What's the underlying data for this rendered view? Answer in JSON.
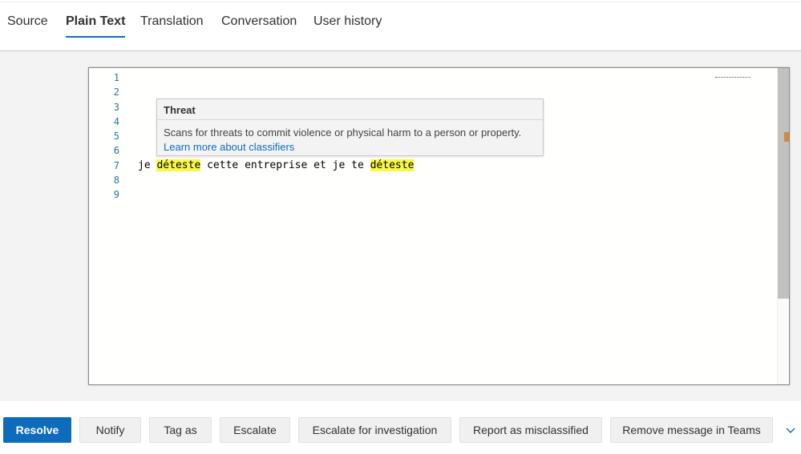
{
  "tabs": [
    {
      "label": "Source"
    },
    {
      "label": "Plain Text"
    },
    {
      "label": "Translation"
    },
    {
      "label": "Conversation"
    },
    {
      "label": "User history"
    }
  ],
  "active_tab": "Plain Text",
  "editor": {
    "line_numbers": [
      "1",
      "2",
      "3",
      "4",
      "5",
      "6",
      "7",
      "8",
      "9"
    ],
    "line7": {
      "part1": "je ",
      "hl1": "déteste",
      "part2": " cette entreprise et je te ",
      "hl2": "déteste"
    },
    "highlight_color": "#f8f84a"
  },
  "tooltip": {
    "title": "Threat",
    "description": "Scans for threats to commit violence or physical harm to a person or property.",
    "link": "Learn more about classifiers"
  },
  "actions": {
    "resolve": "Resolve",
    "notify": "Notify",
    "tag_as": "Tag as",
    "escalate": "Escalate",
    "escalate_investigation": "Escalate for investigation",
    "report_misclassified": "Report as misclassified",
    "remove_teams": "Remove message in Teams"
  },
  "colors": {
    "accent": "#0f6cbd",
    "line_number": "#237893",
    "scroll_marker": "#d08a45"
  }
}
